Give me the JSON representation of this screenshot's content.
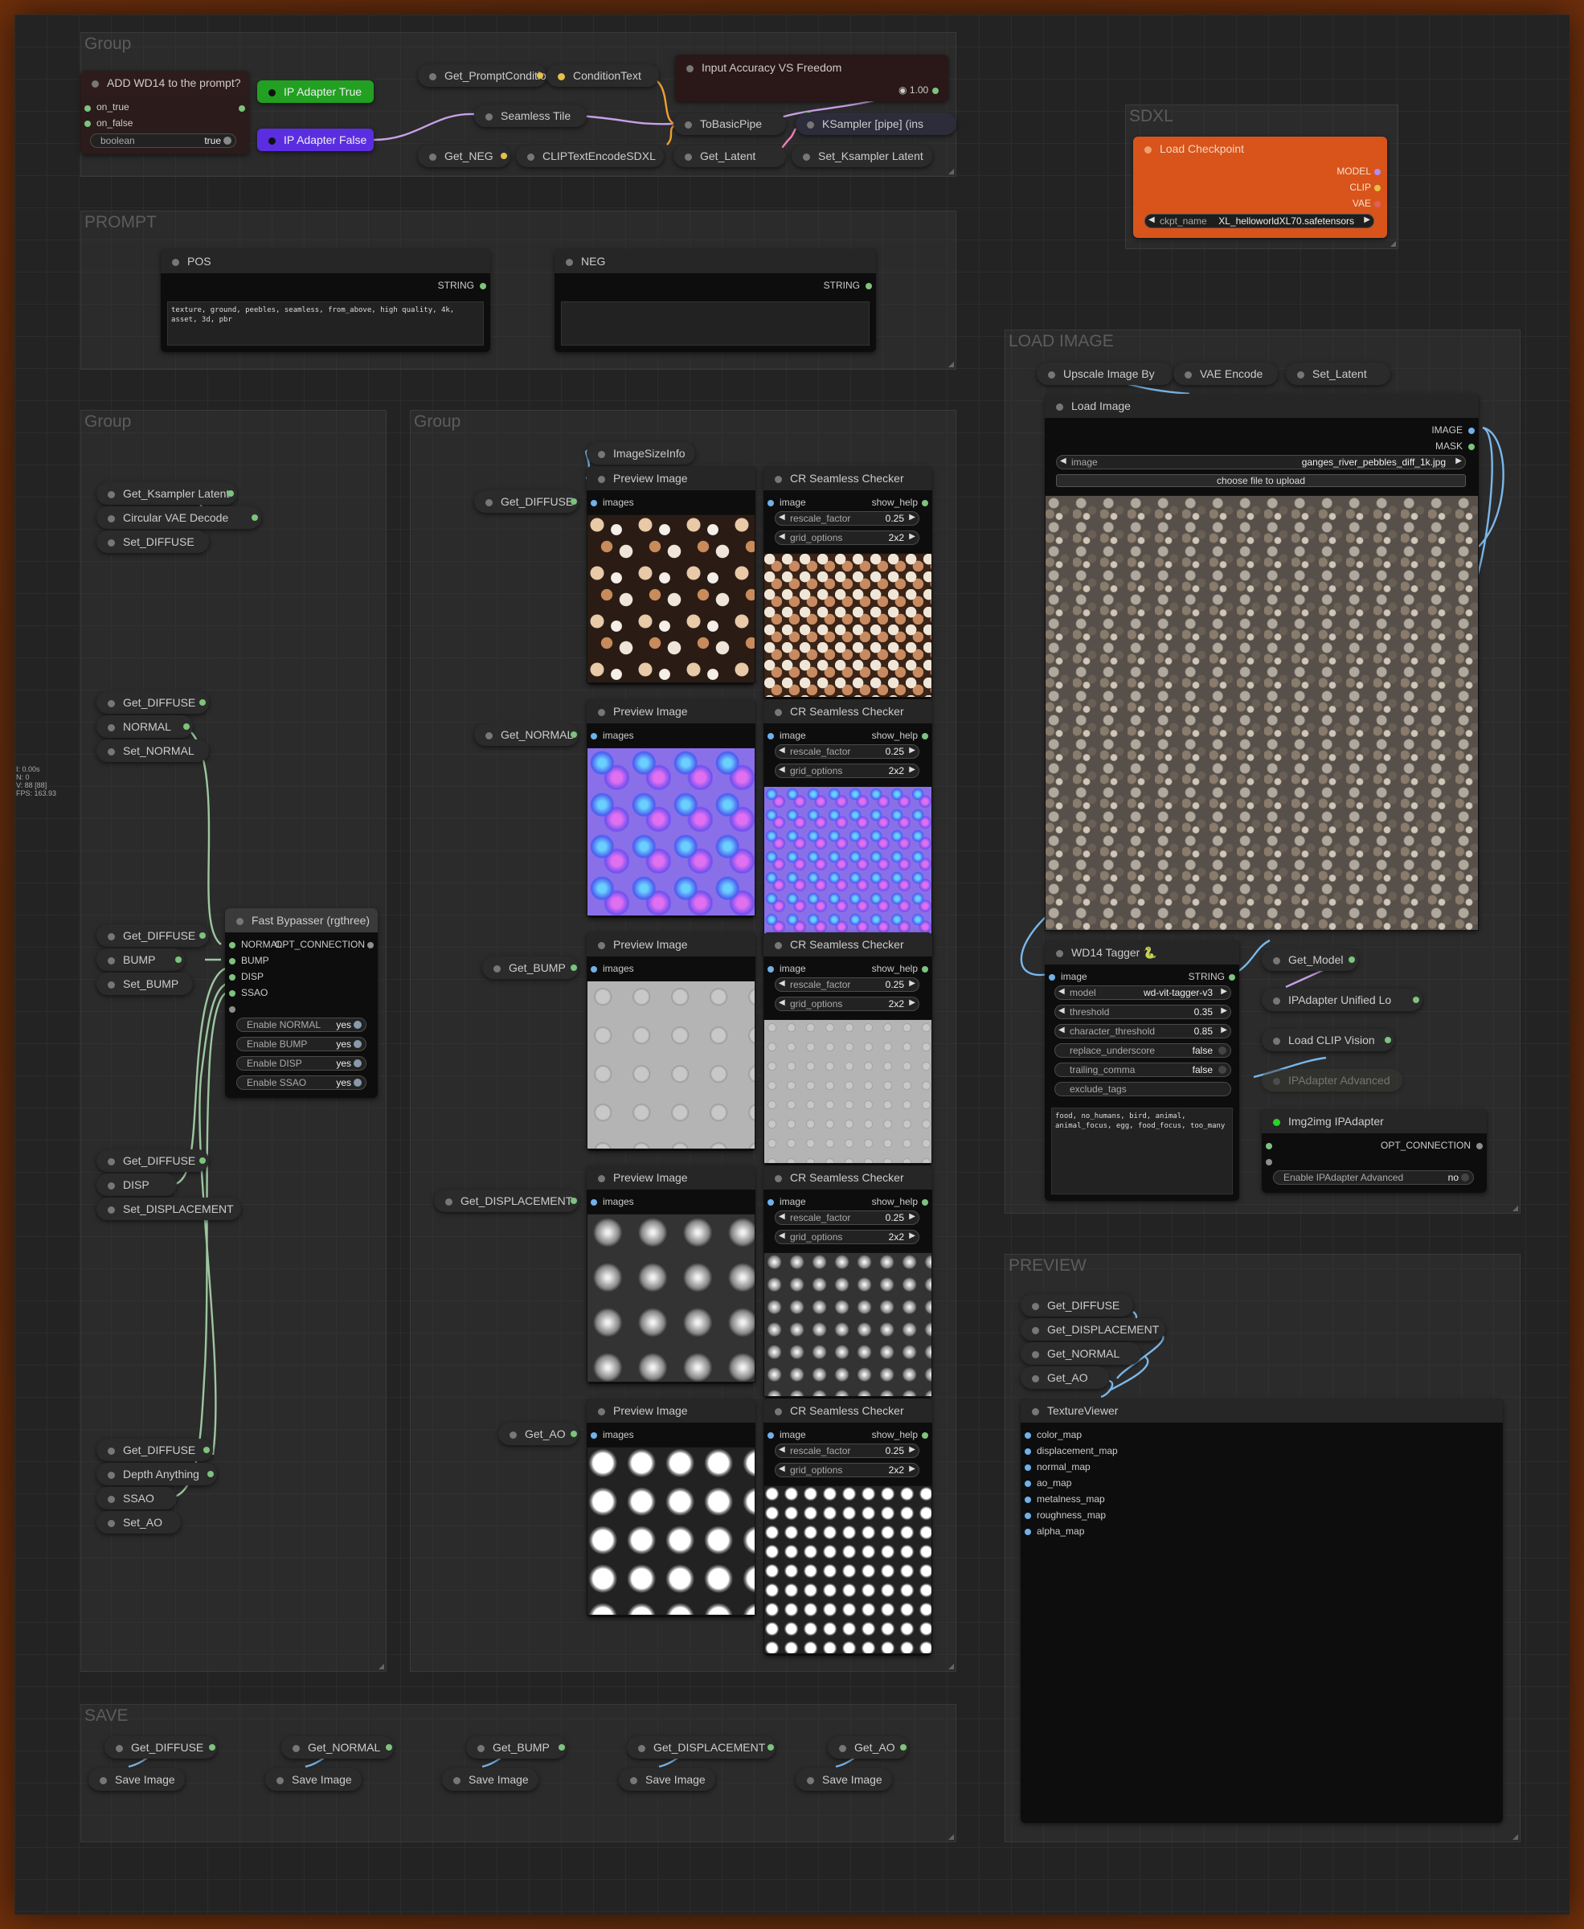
{
  "groups": {
    "g1": "Group",
    "prompt": "PROMPT",
    "g2": "Group",
    "g3": "Group",
    "save": "SAVE",
    "sdxl": "SDXL",
    "load": "LOAD IMAGE",
    "preview": "PREVIEW"
  },
  "stats": [
    "I: 0.00s",
    "N: 0",
    "V: 88 [88]",
    "FPS: 163.93"
  ],
  "top": {
    "wd14_title": "ADD WD14 to the prompt?",
    "on_true": "on_true",
    "on_false": "on_false",
    "bool_label": "boolean",
    "bool_value": "true",
    "ip_true": "IP Adapter True",
    "ip_false": "IP Adapter False",
    "get_prompt": "Get_PromptConditio",
    "condition_text": "ConditionText",
    "input_accuracy": "Input Accuracy VS Freedom",
    "accuracy_value": "1.00",
    "seamless_tile": "Seamless Tile",
    "to_basic_pipe": "ToBasicPipe",
    "ksampler": "KSampler [pipe] (ins",
    "get_neg": "Get_NEG",
    "clip_text": "CLIPTextEncodeSDXL",
    "get_latent": "Get_Latent",
    "set_ksampler": "Set_Ksampler Latent"
  },
  "prompt": {
    "pos_title": "POS",
    "neg_title": "NEG",
    "string": "STRING",
    "pos_text": "texture, ground, peebles, seamless, from_above, high quality, 4k, asset, 3d, pbr",
    "neg_text": ""
  },
  "left": {
    "get_ksampler": "Get_Ksampler Latent",
    "circular_vae": "Circular VAE Decode",
    "set_diffuse": "Set_DIFFUSE",
    "get_diffuse": "Get_DIFFUSE",
    "normal": "NORMAL",
    "set_normal": "Set_NORMAL",
    "bump": "BUMP",
    "set_bump": "Set_BUMP",
    "disp": "DISP",
    "set_displacement": "Set_DISPLACEMENT",
    "depth_anything": "Depth Anything",
    "ssao": "SSAO",
    "set_ao": "Set_AO",
    "bypasser_title": "Fast Bypasser (rgthree)",
    "opt_connection": "OPT_CONNECTION",
    "bypass_inputs": [
      "NORMAL",
      "BUMP",
      "DISP",
      "SSAO"
    ],
    "bypass_toggles": [
      {
        "label": "Enable NORMAL",
        "value": "yes"
      },
      {
        "label": "Enable BUMP",
        "value": "yes"
      },
      {
        "label": "Enable DISP",
        "value": "yes"
      },
      {
        "label": "Enable SSAO",
        "value": "yes"
      }
    ]
  },
  "mid": {
    "image_size_info": "ImageSizeInfo",
    "preview_image": "Preview Image",
    "images": "images",
    "checker": "CR Seamless Checker",
    "image": "image",
    "show_help": "show_help",
    "rescale_label": "rescale_factor",
    "rescale_value": "0.25",
    "grid_label": "grid_options",
    "grid_value": "2x2",
    "get_diffuse": "Get_DIFFUSE",
    "get_normal": "Get_NORMAL",
    "get_bump": "Get_BUMP",
    "get_displacement": "Get_DISPLACEMENT",
    "get_ao": "Get_AO"
  },
  "save": {
    "get": [
      "Get_DIFFUSE",
      "Get_NORMAL",
      "Get_BUMP",
      "Get_DISPLACEMENT",
      "Get_AO"
    ],
    "save_image": "Save Image"
  },
  "sdxl": {
    "title": "Load Checkpoint",
    "outputs": [
      "MODEL",
      "CLIP",
      "VAE"
    ],
    "ckpt_label": "ckpt_name",
    "ckpt_value": "XL_helloworldXL70.safetensors"
  },
  "load": {
    "upscale": "Upscale Image By",
    "vae_encode": "VAE Encode",
    "set_latent": "Set_Latent",
    "load_image": "Load Image",
    "out_image": "IMAGE",
    "out_mask": "MASK",
    "image_label": "image",
    "image_value": "ganges_river_pebbles_diff_1k.jpg",
    "upload": "choose file to upload",
    "tagger_title": "WD14 Tagger 🐍",
    "tagger_image": "image",
    "tagger_string": "STRING",
    "tagger_widgets": [
      {
        "label": "model",
        "value": "wd-vit-tagger-v3"
      },
      {
        "label": "threshold",
        "value": "0.35"
      },
      {
        "label": "character_threshold",
        "value": "0.85"
      },
      {
        "label": "replace_underscore",
        "value": "false"
      },
      {
        "label": "trailing_comma",
        "value": "false"
      },
      {
        "label": "exclude_tags",
        "value": ""
      }
    ],
    "tagger_text": "food, no_humans, bird, animal, animal_focus, egg, food_focus, too_many",
    "get_model": "Get_Model",
    "ipadapter_unified": "IPAdapter Unified Lo",
    "load_clip_vision": "Load CLIP Vision",
    "ipadapter_advanced": "IPAdapter Advanced",
    "img2img": "Img2img IPAdapter",
    "opt_connection": "OPT_CONNECTION",
    "enable_ipa": "Enable IPAdapter Advanced",
    "enable_ipa_value": "no"
  },
  "preview": {
    "gets": [
      "Get_DIFFUSE",
      "Get_DISPLACEMENT",
      "Get_NORMAL",
      "Get_AO"
    ],
    "viewer": "TextureViewer",
    "maps": [
      "color_map",
      "displacement_map",
      "normal_map",
      "ao_map",
      "metalness_map",
      "roughness_map",
      "alpha_map"
    ]
  },
  "colors": {
    "checkpoint": "#d8541a",
    "ip_true": "#2a9d2a",
    "ip_false": "#5b2dd6",
    "wire_blue": "#7ab8ec",
    "wire_green": "#9cc7a0",
    "wire_purple": "#c8a0e8",
    "wire_orange": "#f0a030"
  }
}
